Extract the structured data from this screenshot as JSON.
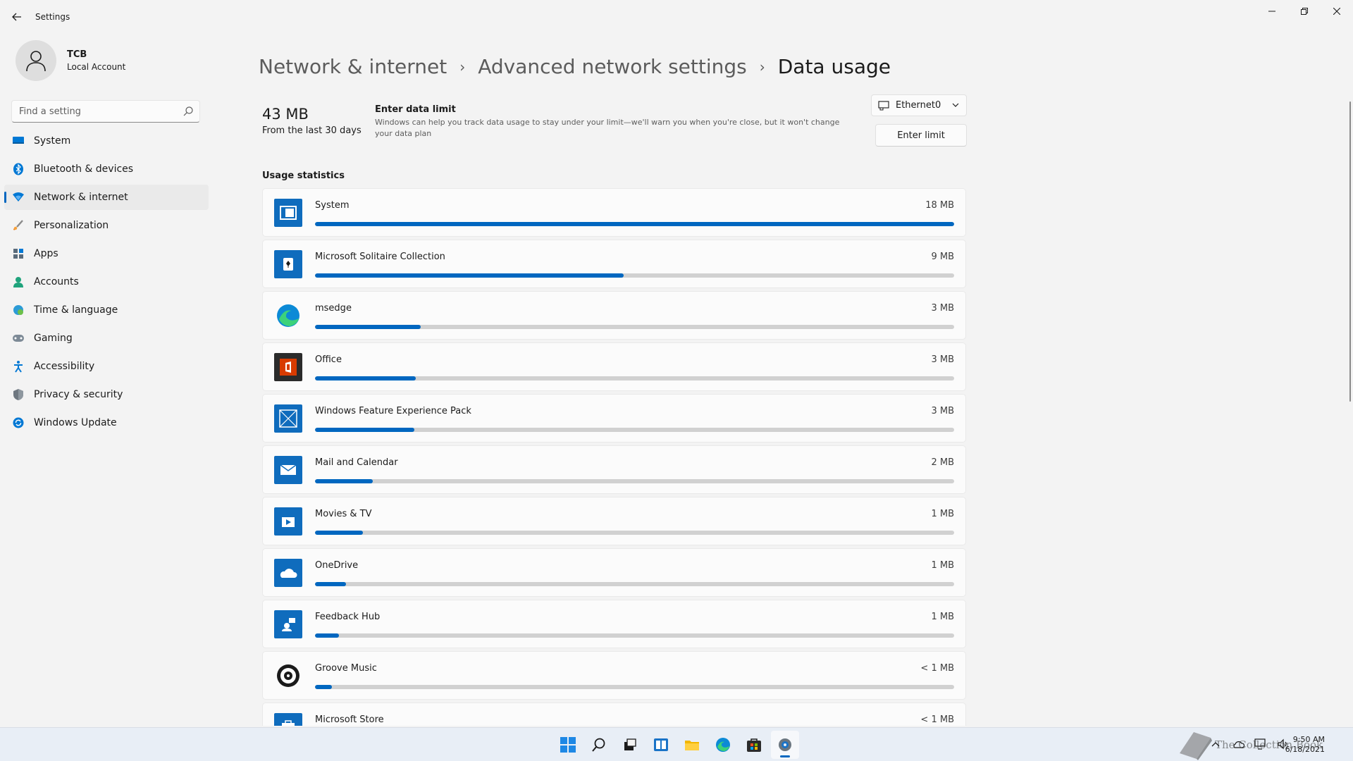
{
  "window": {
    "title": "Settings"
  },
  "profile": {
    "name": "TCB",
    "account_type": "Local Account"
  },
  "search": {
    "placeholder": "Find a setting"
  },
  "sidebar": {
    "items": [
      {
        "label": "System",
        "icon": "monitor-icon"
      },
      {
        "label": "Bluetooth & devices",
        "icon": "bluetooth-icon"
      },
      {
        "label": "Network & internet",
        "icon": "wifi-icon",
        "active": true
      },
      {
        "label": "Personalization",
        "icon": "brush-icon"
      },
      {
        "label": "Apps",
        "icon": "apps-icon"
      },
      {
        "label": "Accounts",
        "icon": "person-icon"
      },
      {
        "label": "Time & language",
        "icon": "globe-clock-icon"
      },
      {
        "label": "Gaming",
        "icon": "gamepad-icon"
      },
      {
        "label": "Accessibility",
        "icon": "accessibility-icon"
      },
      {
        "label": "Privacy & security",
        "icon": "shield-icon"
      },
      {
        "label": "Windows Update",
        "icon": "update-icon"
      }
    ]
  },
  "breadcrumb": {
    "level1": "Network & internet",
    "level2": "Advanced network settings",
    "current": "Data usage"
  },
  "summary": {
    "total": "43 MB",
    "period": "From the last 30 days"
  },
  "limit": {
    "title": "Enter data limit",
    "description": "Windows can help you track data usage to stay under your limit—we'll warn you when you're close, but it won't change your data plan",
    "button": "Enter limit"
  },
  "adapter": {
    "selected": "Ethernet0"
  },
  "stats": {
    "title": "Usage statistics",
    "apps": [
      {
        "name": "System",
        "value": "18 MB",
        "fraction": 1.0,
        "icon": "system-app-icon",
        "color": "#0f6cbd"
      },
      {
        "name": "Microsoft Solitaire Collection",
        "value": "9 MB",
        "fraction": 0.483,
        "icon": "solitaire-icon",
        "color": "#0f6cbd"
      },
      {
        "name": "msedge",
        "value": "3 MB",
        "fraction": 0.165,
        "icon": "edge-icon",
        "color": "#0f6cbd"
      },
      {
        "name": "Office",
        "value": "3 MB",
        "fraction": 0.158,
        "icon": "office-icon",
        "color": "#2b2b2b"
      },
      {
        "name": "Windows Feature Experience Pack",
        "value": "3 MB",
        "fraction": 0.155,
        "icon": "feature-pack-icon",
        "color": "#0f6cbd"
      },
      {
        "name": "Mail and Calendar",
        "value": "2 MB",
        "fraction": 0.09,
        "icon": "mail-icon",
        "color": "#0f6cbd"
      },
      {
        "name": "Movies & TV",
        "value": "1 MB",
        "fraction": 0.075,
        "icon": "movies-icon",
        "color": "#0f6cbd"
      },
      {
        "name": "OneDrive",
        "value": "1 MB",
        "fraction": 0.048,
        "icon": "onedrive-icon",
        "color": "#0f6cbd"
      },
      {
        "name": "Feedback Hub",
        "value": "1 MB",
        "fraction": 0.037,
        "icon": "feedback-icon",
        "color": "#0f6cbd"
      },
      {
        "name": "Groove Music",
        "value": "< 1 MB",
        "fraction": 0.026,
        "icon": "groove-icon",
        "color": "#0f6cbd"
      },
      {
        "name": "Microsoft Store",
        "value": "< 1 MB",
        "fraction": 0.02,
        "icon": "store-icon",
        "color": "#0f6cbd"
      }
    ]
  },
  "taskbar": {
    "apps": [
      "start-icon",
      "search-icon",
      "task-view-icon",
      "widgets-icon",
      "file-explorer-icon",
      "edge-icon",
      "store-icon",
      "settings-icon"
    ],
    "time": "9:50 AM",
    "date": "6/18/2021",
    "watermark": "The Collection Book"
  },
  "colors": {
    "accent": "#0067c0",
    "background": "#f3f3f3",
    "card": "#fbfbfb",
    "track": "#d1d1d1"
  }
}
